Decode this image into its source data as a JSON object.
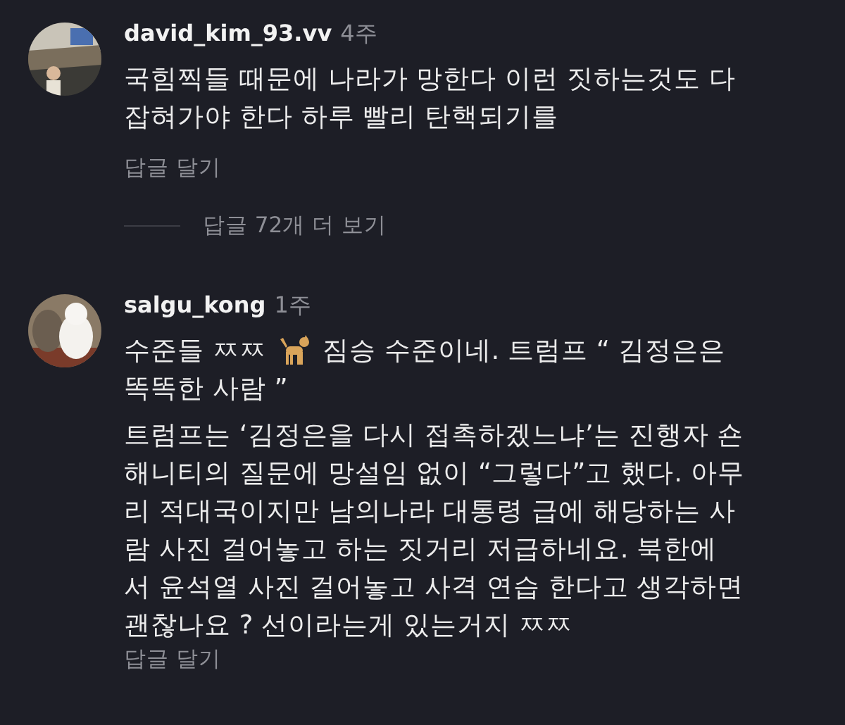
{
  "comments": [
    {
      "username": "david_kim_93.vv",
      "time": "4주",
      "paragraphs": [
        [
          [
            {
              "kind": "text",
              "text": "국힘찍들 때문에 나라가 망한다 이런 짓하는것도 다"
            }
          ],
          [
            {
              "kind": "text",
              "text": "잡혀가야 한다 하루 빨리 탄핵되기를"
            }
          ]
        ]
      ],
      "reply_link": "답글 달기",
      "more_replies": "답글 72개 더 보기"
    },
    {
      "username": "salgu_kong",
      "time": "1주",
      "paragraphs": [
        [
          [
            {
              "kind": "text",
              "text": "수준들 ㅉㅉ"
            },
            {
              "kind": "icon"
            },
            {
              "kind": "text",
              "text": "짐승 수준이네.  트럼프 “ 김정은은"
            }
          ],
          [
            {
              "kind": "text",
              "text": "똑똑한 사람 ”"
            }
          ]
        ],
        [
          [
            {
              "kind": "text",
              "text": "트럼프는 ‘김정은을 다시 접촉하겠느냐’는 진행자 숀"
            }
          ],
          [
            {
              "kind": "text",
              "text": "해니티의 질문에 망설임 없이 “그렇다”고 했다. 아무"
            }
          ],
          [
            {
              "kind": "text",
              "text": "리 적대국이지만 남의나라 대통령 급에 해당하는 사"
            }
          ],
          [
            {
              "kind": "text",
              "text": "람 사진 걸어놓고 하는 짓거리 저급하네요.  북한에"
            }
          ],
          [
            {
              "kind": "text",
              "text": "서 윤석열 사진 걸어놓고 사격 연습 한다고 생각하면"
            }
          ],
          [
            {
              "kind": "text",
              "text": "괜찮나요 ? 선이라는게 있는거지 ㅉㅉ"
            }
          ]
        ]
      ],
      "reply_link": "답글 달기"
    }
  ]
}
